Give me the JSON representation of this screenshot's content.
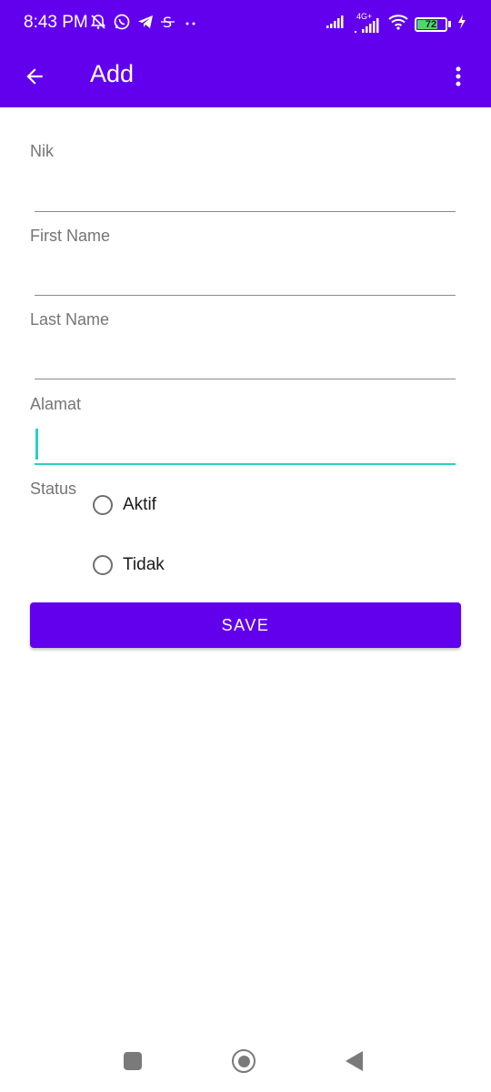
{
  "status_bar": {
    "time": "8:43 PM",
    "network_label": "4G+",
    "battery_level": "72",
    "battery_fraction": 0.72,
    "icons": [
      "mute-icon",
      "whatsapp-icon",
      "telegram-icon",
      "s-app-icon",
      "more-notifications-icon",
      "signal-icon",
      "signal-4g-icon",
      "wifi-icon",
      "battery-icon",
      "charging-icon"
    ]
  },
  "toolbar": {
    "title": "Add",
    "back_icon": "arrow-back-icon",
    "overflow_icon": "more-vert-icon"
  },
  "form": {
    "nik": {
      "label": "Nik",
      "value": ""
    },
    "first_name": {
      "label": "First Name",
      "value": ""
    },
    "last_name": {
      "label": "Last Name",
      "value": ""
    },
    "alamat": {
      "label": "Alamat",
      "value": ""
    },
    "status": {
      "label": "Status",
      "options": [
        {
          "label": "Aktif",
          "checked": false
        },
        {
          "label": "Tidak",
          "checked": false
        }
      ]
    },
    "save_label": "SAVE"
  },
  "nav_bar": {
    "icons": [
      "recents-icon",
      "home-icon",
      "back-icon"
    ]
  },
  "colors": {
    "primary": "#6200ee",
    "accent": "#2ad0c4"
  }
}
